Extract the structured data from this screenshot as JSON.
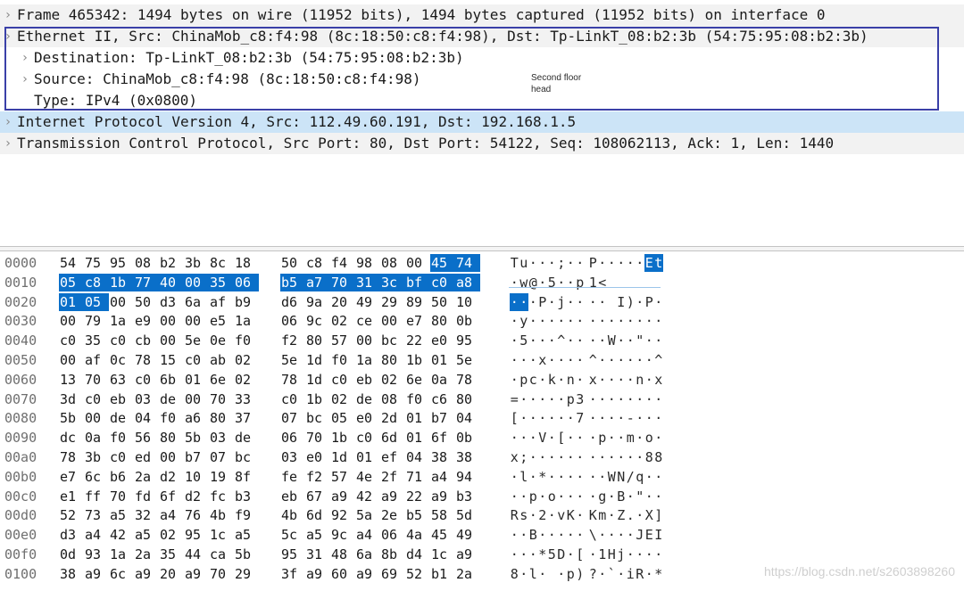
{
  "details": {
    "rows": [
      {
        "text": "Frame 465342: 1494 bytes on wire (11952 bits), 1494 bytes captured (11952 bits) on interface 0",
        "level": 0,
        "selected": false,
        "name": "tree-frame"
      },
      {
        "text": "Ethernet II, Src: ChinaMob_c8:f4:98 (8c:18:50:c8:f4:98), Dst: Tp-LinkT_08:b2:3b (54:75:95:08:b2:3b)",
        "level": 0,
        "selected": false,
        "name": "tree-ethernet"
      },
      {
        "text": "Destination: Tp-LinkT_08:b2:3b (54:75:95:08:b2:3b)",
        "level": 1,
        "selected": false,
        "name": "tree-eth-destination"
      },
      {
        "text": "Source: ChinaMob_c8:f4:98 (8c:18:50:c8:f4:98)",
        "level": 1,
        "selected": false,
        "name": "tree-eth-source"
      },
      {
        "text": "Type: IPv4 (0x0800)",
        "level": 1,
        "leaf": true,
        "selected": false,
        "name": "tree-eth-type"
      },
      {
        "text": "Internet Protocol Version 4, Src: 112.49.60.191, Dst: 192.168.1.5",
        "level": 0,
        "selected": true,
        "name": "tree-ipv4"
      },
      {
        "text": "Transmission Control Protocol, Src Port: 80, Dst Port: 54122, Seq: 108062113, Ack: 1, Len: 1440",
        "level": 0,
        "selected": false,
        "name": "tree-tcp"
      }
    ],
    "note_line1": "Second floor",
    "note_line2": "head"
  },
  "bytes": {
    "rows": [
      {
        "offset": "0000",
        "hex": [
          "54",
          "75",
          "95",
          "08",
          "b2",
          "3b",
          "8c",
          "18",
          "50",
          "c8",
          "f4",
          "98",
          "08",
          "00",
          "45",
          "74"
        ],
        "ascii": [
          "T",
          "u",
          "·",
          "·",
          "·",
          ";",
          "·",
          "·",
          "P",
          "·",
          "·",
          "·",
          "·",
          "·",
          "E",
          "t"
        ],
        "hl_from": 14
      },
      {
        "offset": "0010",
        "hex": [
          "05",
          "c8",
          "1b",
          "77",
          "40",
          "00",
          "35",
          "06",
          "b5",
          "a7",
          "70",
          "31",
          "3c",
          "bf",
          "c0",
          "a8"
        ],
        "ascii": [
          "·",
          "w",
          "@",
          "·",
          "5",
          "·",
          "·",
          "p",
          "1",
          "<",
          "",
          "",
          "",
          "",
          "",
          ""
        ],
        "hl_from": 0
      },
      {
        "offset": "0020",
        "hex": [
          "01",
          "05",
          "00",
          "50",
          "d3",
          "6a",
          "af",
          "b9",
          "d6",
          "9a",
          "20",
          "49",
          "29",
          "89",
          "50",
          "10"
        ],
        "ascii": [
          "·",
          "·",
          "·",
          "P",
          "·",
          "j",
          "·",
          "·",
          "·",
          "·",
          " ",
          "I",
          ")",
          "·",
          "P",
          "·"
        ],
        "hl_to": 2
      },
      {
        "offset": "0030",
        "hex": [
          "00",
          "79",
          "1a",
          "e9",
          "00",
          "00",
          "e5",
          "1a",
          "06",
          "9c",
          "02",
          "ce",
          "00",
          "e7",
          "80",
          "0b"
        ],
        "ascii": [
          "·",
          "y",
          "·",
          "·",
          "·",
          "·",
          "·",
          "·",
          "·",
          "·",
          "·",
          "·",
          "·",
          "·",
          "·",
          "·"
        ]
      },
      {
        "offset": "0040",
        "hex": [
          "c0",
          "35",
          "c0",
          "cb",
          "00",
          "5e",
          "0e",
          "f0",
          "f2",
          "80",
          "57",
          "00",
          "bc",
          "22",
          "e0",
          "95"
        ],
        "ascii": [
          "·",
          "5",
          "·",
          "·",
          "·",
          "^",
          "·",
          "·",
          "·",
          "·",
          "W",
          "·",
          "·",
          "\"",
          "·",
          "·"
        ]
      },
      {
        "offset": "0050",
        "hex": [
          "00",
          "af",
          "0c",
          "78",
          "15",
          "c0",
          "ab",
          "02",
          "5e",
          "1d",
          "f0",
          "1a",
          "80",
          "1b",
          "01",
          "5e"
        ],
        "ascii": [
          "·",
          "·",
          "·",
          "x",
          "·",
          "·",
          "·",
          "·",
          "^",
          "·",
          "·",
          "·",
          "·",
          "·",
          "·",
          "^"
        ]
      },
      {
        "offset": "0060",
        "hex": [
          "13",
          "70",
          "63",
          "c0",
          "6b",
          "01",
          "6e",
          "02",
          "78",
          "1d",
          "c0",
          "eb",
          "02",
          "6e",
          "0a",
          "78"
        ],
        "ascii": [
          "·",
          "p",
          "c",
          "·",
          "k",
          "·",
          "n",
          "·",
          "x",
          "·",
          "·",
          "·",
          "·",
          "n",
          "·",
          "x"
        ]
      },
      {
        "offset": "0070",
        "hex": [
          "3d",
          "c0",
          "eb",
          "03",
          "de",
          "00",
          "70",
          "33",
          "c0",
          "1b",
          "02",
          "de",
          "08",
          "f0",
          "c6",
          "80"
        ],
        "ascii": [
          "=",
          "·",
          "·",
          "·",
          "·",
          "·",
          "p",
          "3",
          "·",
          "·",
          "·",
          "·",
          "·",
          "·",
          "·",
          "·"
        ]
      },
      {
        "offset": "0080",
        "hex": [
          "5b",
          "00",
          "de",
          "04",
          "f0",
          "a6",
          "80",
          "37",
          "07",
          "bc",
          "05",
          "e0",
          "2d",
          "01",
          "b7",
          "04"
        ],
        "ascii": [
          "[",
          "·",
          "·",
          "·",
          "·",
          "·",
          "·",
          "7",
          "·",
          "·",
          "·",
          "·",
          "-",
          "·",
          "·",
          "·"
        ]
      },
      {
        "offset": "0090",
        "hex": [
          "dc",
          "0a",
          "f0",
          "56",
          "80",
          "5b",
          "03",
          "de",
          "06",
          "70",
          "1b",
          "c0",
          "6d",
          "01",
          "6f",
          "0b"
        ],
        "ascii": [
          "·",
          "·",
          "·",
          "V",
          "·",
          "[",
          "·",
          "·",
          "·",
          "p",
          "·",
          "·",
          "m",
          "·",
          "o",
          "·"
        ]
      },
      {
        "offset": "00a0",
        "hex": [
          "78",
          "3b",
          "c0",
          "ed",
          "00",
          "b7",
          "07",
          "bc",
          "03",
          "e0",
          "1d",
          "01",
          "ef",
          "04",
          "38",
          "38"
        ],
        "ascii": [
          "x",
          ";",
          "·",
          "·",
          "·",
          "·",
          "·",
          "·",
          "·",
          "·",
          "·",
          "·",
          "·",
          "·",
          "8",
          "8"
        ]
      },
      {
        "offset": "00b0",
        "hex": [
          "e7",
          "6c",
          "b6",
          "2a",
          "d2",
          "10",
          "19",
          "8f",
          "fe",
          "f2",
          "57",
          "4e",
          "2f",
          "71",
          "a4",
          "94"
        ],
        "ascii": [
          "·",
          "l",
          "·",
          "*",
          "·",
          "·",
          "·",
          "·",
          "·",
          "·",
          "W",
          "N",
          "/",
          "q",
          "·",
          "·"
        ]
      },
      {
        "offset": "00c0",
        "hex": [
          "e1",
          "ff",
          "70",
          "fd",
          "6f",
          "d2",
          "fc",
          "b3",
          "eb",
          "67",
          "a9",
          "42",
          "a9",
          "22",
          "a9",
          "b3"
        ],
        "ascii": [
          "·",
          "·",
          "p",
          "·",
          "o",
          "·",
          "·",
          "·",
          "·",
          "g",
          "·",
          "B",
          "·",
          "\"",
          "·",
          "·"
        ]
      },
      {
        "offset": "00d0",
        "hex": [
          "52",
          "73",
          "a5",
          "32",
          "a4",
          "76",
          "4b",
          "f9",
          "4b",
          "6d",
          "92",
          "5a",
          "2e",
          "b5",
          "58",
          "5d"
        ],
        "ascii": [
          "R",
          "s",
          "·",
          "2",
          "·",
          "v",
          "K",
          "·",
          "K",
          "m",
          "·",
          "Z",
          ".",
          "·",
          "X",
          "]"
        ]
      },
      {
        "offset": "00e0",
        "hex": [
          "d3",
          "a4",
          "42",
          "a5",
          "02",
          "95",
          "1c",
          "a5",
          "5c",
          "a5",
          "9c",
          "a4",
          "06",
          "4a",
          "45",
          "49"
        ],
        "ascii": [
          "·",
          "·",
          "B",
          "·",
          "·",
          "·",
          "·",
          "·",
          "\\",
          "·",
          "·",
          "·",
          "·",
          "J",
          "E",
          "I"
        ]
      },
      {
        "offset": "00f0",
        "hex": [
          "0d",
          "93",
          "1a",
          "2a",
          "35",
          "44",
          "ca",
          "5b",
          "95",
          "31",
          "48",
          "6a",
          "8b",
          "d4",
          "1c",
          "a9"
        ],
        "ascii": [
          "·",
          "·",
          "·",
          "*",
          "5",
          "D",
          "·",
          "[",
          "·",
          "1",
          "H",
          "j",
          "·",
          "·",
          "·",
          "·"
        ]
      },
      {
        "offset": "0100",
        "hex": [
          "38",
          "a9",
          "6c",
          "a9",
          "20",
          "a9",
          "70",
          "29",
          "3f",
          "a9",
          "60",
          "a9",
          "69",
          "52",
          "b1",
          "2a"
        ],
        "ascii": [
          "8",
          "·",
          "l",
          "·",
          " ",
          "·",
          "p",
          ")",
          "?",
          "·",
          "`",
          "·",
          "i",
          "R",
          "·",
          "*"
        ]
      }
    ]
  },
  "watermark": "https://blog.csdn.net/s2603898260",
  "colors": {
    "selection": "#cce4f7",
    "byte_highlight": "#0a6fc9",
    "annotation_box": "#3a40a8"
  }
}
